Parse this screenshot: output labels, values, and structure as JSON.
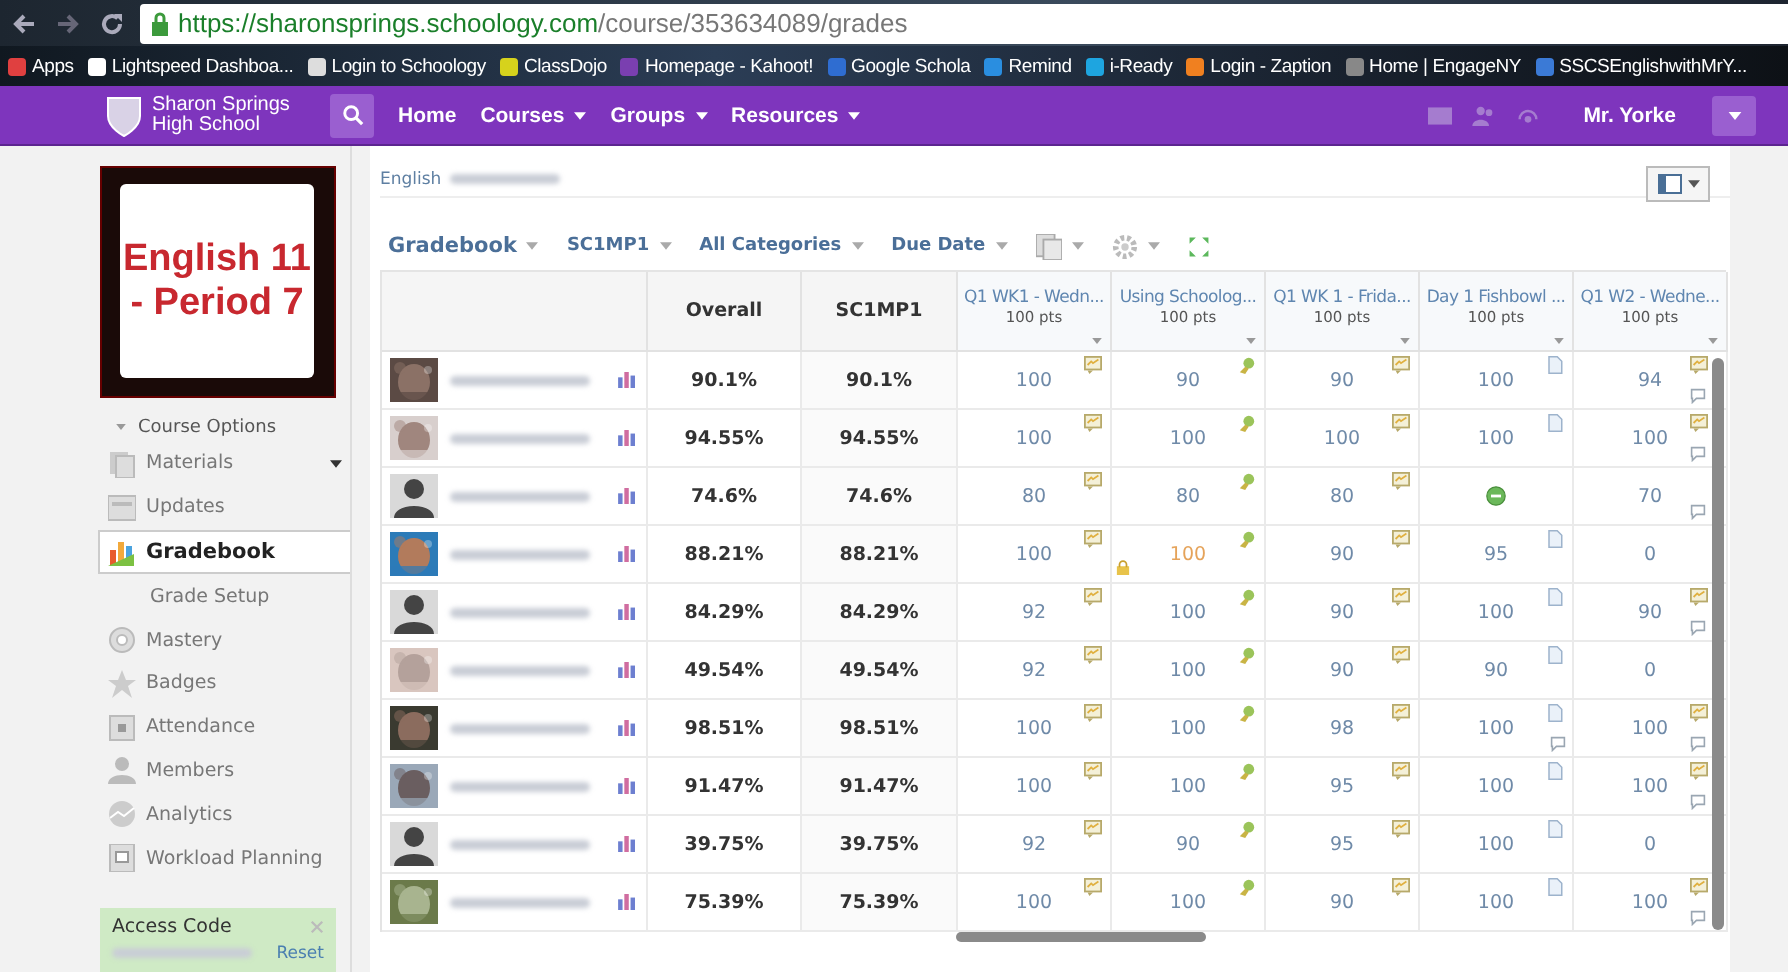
{
  "browser": {
    "url_host": "https://sharonsprings.schoology.com",
    "url_path": "/course/353634089/grades",
    "bookmarks": [
      "Apps",
      "Lightspeed Dashboa...",
      "Login to Schoology",
      "ClassDojo",
      "Homepage - Kahoot!",
      "Google Schola",
      "Remind",
      "i-Ready",
      "Login - Zaption",
      "Home | EngageNY",
      "SSCSEnglishwithMrY..."
    ]
  },
  "nav": {
    "school": "Sharon Springs High School",
    "links": [
      {
        "label": "Home",
        "dropdown": false
      },
      {
        "label": "Courses",
        "dropdown": true
      },
      {
        "label": "Groups",
        "dropdown": true
      },
      {
        "label": "Resources",
        "dropdown": true
      }
    ],
    "user": "Mr. Yorke"
  },
  "sidebar": {
    "course_image_text": "English 11 - Period 7",
    "course_options": "Course Options",
    "items": [
      {
        "label": "Materials",
        "kind": "menu",
        "selected": false
      },
      {
        "label": "Updates",
        "kind": "item",
        "selected": false
      },
      {
        "label": "Gradebook",
        "kind": "item",
        "selected": true
      },
      {
        "label": "Grade Setup",
        "kind": "sub",
        "selected": false
      },
      {
        "label": "Mastery",
        "kind": "item",
        "selected": false
      },
      {
        "label": "Badges",
        "kind": "item",
        "selected": false
      },
      {
        "label": "Attendance",
        "kind": "item",
        "selected": false
      },
      {
        "label": "Members",
        "kind": "item",
        "selected": false
      },
      {
        "label": "Analytics",
        "kind": "item",
        "selected": false
      },
      {
        "label": "Workload Planning",
        "kind": "item",
        "selected": false
      }
    ],
    "access_code": {
      "title": "Access Code",
      "reset": "Reset"
    }
  },
  "breadcrumb": "English",
  "toolbar": [
    "Gradebook",
    "SC1MP1",
    "All Categories",
    "Due Date"
  ],
  "table": {
    "summary_columns": [
      "Overall",
      "SC1MP1"
    ],
    "columns": [
      {
        "title": "Q1 WK1 - Wedn...",
        "points": "100 pts",
        "kind": "assignment"
      },
      {
        "title": "Using Schoolog...",
        "points": "100 pts",
        "kind": "discussion"
      },
      {
        "title": "Q1 WK 1 - Frida...",
        "points": "100 pts",
        "kind": "assignment"
      },
      {
        "title": "Day 1 Fishbowl ...",
        "points": "100 pts",
        "kind": "document"
      },
      {
        "title": "Q1 W2 - Wedne...",
        "points": "100 pts",
        "kind": "assignment"
      }
    ],
    "rows": [
      {
        "overall": "90.1%",
        "period": "90.1%",
        "grades": [
          {
            "value": "100"
          },
          {
            "value": "90"
          },
          {
            "value": "90"
          },
          {
            "value": "100"
          },
          {
            "value": "94",
            "comment": true
          }
        ]
      },
      {
        "overall": "94.55%",
        "period": "94.55%",
        "grades": [
          {
            "value": "100"
          },
          {
            "value": "100"
          },
          {
            "value": "100"
          },
          {
            "value": "100"
          },
          {
            "value": "100",
            "comment": true
          }
        ]
      },
      {
        "kind": "silhouette",
        "overall": "74.6%",
        "period": "74.6%",
        "grades": [
          {
            "value": "80"
          },
          {
            "value": "80"
          },
          {
            "value": "80"
          },
          {
            "excused": true,
            "no_icon": true
          },
          {
            "value": "70",
            "comment": true,
            "no_icon": true
          }
        ]
      },
      {
        "overall": "88.21%",
        "period": "88.21%",
        "grades": [
          {
            "value": "100"
          },
          {
            "value": "100",
            "locked": true
          },
          {
            "value": "90"
          },
          {
            "value": "95"
          },
          {
            "value": "0",
            "no_icon": true
          }
        ]
      },
      {
        "kind": "silhouette",
        "overall": "84.29%",
        "period": "84.29%",
        "grades": [
          {
            "value": "92"
          },
          {
            "value": "100"
          },
          {
            "value": "90"
          },
          {
            "value": "100"
          },
          {
            "value": "90",
            "comment": true
          }
        ]
      },
      {
        "overall": "49.54%",
        "period": "49.54%",
        "grades": [
          {
            "value": "92"
          },
          {
            "value": "100"
          },
          {
            "value": "90"
          },
          {
            "value": "90"
          },
          {
            "value": "0",
            "no_icon": true
          }
        ]
      },
      {
        "overall": "98.51%",
        "period": "98.51%",
        "grades": [
          {
            "value": "100"
          },
          {
            "value": "100"
          },
          {
            "value": "98"
          },
          {
            "value": "100",
            "comment": true
          },
          {
            "value": "100",
            "comment": true
          }
        ]
      },
      {
        "overall": "91.47%",
        "period": "91.47%",
        "grades": [
          {
            "value": "100"
          },
          {
            "value": "100"
          },
          {
            "value": "95"
          },
          {
            "value": "100"
          },
          {
            "value": "100",
            "comment": true
          }
        ]
      },
      {
        "kind": "silhouette",
        "overall": "39.75%",
        "period": "39.75%",
        "grades": [
          {
            "value": "92"
          },
          {
            "value": "90"
          },
          {
            "value": "95"
          },
          {
            "value": "100"
          },
          {
            "value": "0",
            "no_icon": true
          }
        ]
      },
      {
        "overall": "75.39%",
        "period": "75.39%",
        "grades": [
          {
            "value": "100"
          },
          {
            "value": "100"
          },
          {
            "value": "90"
          },
          {
            "value": "100"
          },
          {
            "value": "100",
            "comment": true
          }
        ]
      }
    ]
  }
}
